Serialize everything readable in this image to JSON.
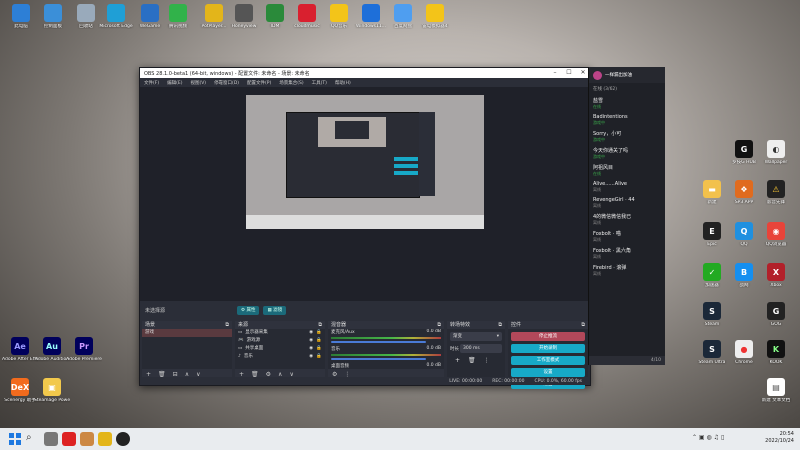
{
  "desktop": {
    "top_icons": [
      {
        "label": "此电脑",
        "color": "#2d7fd6"
      },
      {
        "label": "控制面板",
        "color": "#3b8fd8"
      },
      {
        "label": "回收站",
        "color": "#9ab"
      },
      {
        "label": "Microsoft Edge",
        "color": "#1f9fd6"
      },
      {
        "label": "WeGame",
        "color": "#2a6fc4"
      },
      {
        "label": "腾讯视频",
        "color": "#31b24a"
      },
      {
        "label": "PotPlayer...",
        "color": "#e3b51a"
      },
      {
        "label": "Honeyview",
        "color": "#555"
      },
      {
        "label": "IDM",
        "color": "#2a8a3a"
      },
      {
        "label": "cloudmusic",
        "color": "#d9202f"
      },
      {
        "label": "QQ音乐",
        "color": "#f3c419"
      },
      {
        "label": "Windows11...",
        "color": "#1e6fd9"
      },
      {
        "label": "百度网盘",
        "color": "#4f9ef0"
      },
      {
        "label": "雷电模拟器4",
        "color": "#f3c419"
      }
    ],
    "left_icons": [
      {
        "label": "Adobe After Effects 2021",
        "glyph": "Ae",
        "color": "#00005b",
        "fg": "#9999ff"
      },
      {
        "label": "Adobe Audition",
        "glyph": "Au",
        "color": "#00005b",
        "fg": "#9ff"
      },
      {
        "label": "Adobe Premiere",
        "glyph": "Pr",
        "color": "#00005b",
        "fg": "#c9f"
      },
      {
        "label": "Scenergy 助手",
        "glyph": "DeX",
        "color": "#f26b1d",
        "fg": "#fff"
      },
      {
        "label": "Steamage Power 助手",
        "glyph": "▣",
        "color": "#f2c94c",
        "fg": "#fff"
      }
    ],
    "right_icons": [
      {
        "label": "罗技G HUB",
        "glyph": "G",
        "color": "#111",
        "fg": "#fff"
      },
      {
        "label": "Wallpaper",
        "glyph": "◐",
        "color": "#eee",
        "fg": "#333"
      },
      {
        "label": "影音先锋",
        "glyph": "⚠",
        "color": "#222",
        "fg": "#fc3"
      },
      {
        "label": "SP3 APP",
        "glyph": "❖",
        "color": "#e06b1e",
        "fg": "#fff"
      },
      {
        "label": "新建",
        "glyph": "▬",
        "color": "#f2c14c",
        "fg": "#fff"
      },
      {
        "label": "QQ",
        "glyph": "Q",
        "color": "#1f90e0",
        "fg": "#fff"
      },
      {
        "label": "QQ浏览器",
        "glyph": "◉",
        "color": "#e8443a",
        "fg": "#fff"
      },
      {
        "label": "Epic",
        "glyph": "E",
        "color": "#222",
        "fg": "#fff"
      },
      {
        "label": "加速器",
        "glyph": "✓",
        "color": "#2a2",
        "fg": "#fff"
      },
      {
        "label": "Xbox",
        "glyph": "X",
        "color": "#b2202a",
        "fg": "#fff"
      },
      {
        "label": "Steam",
        "glyph": "S",
        "color": "#1b2838",
        "fg": "#fff"
      },
      {
        "label": "战网",
        "glyph": "B",
        "color": "#158ff0",
        "fg": "#fff"
      },
      {
        "label": "GOG",
        "glyph": "G",
        "color": "#222",
        "fg": "#fff"
      },
      {
        "label": "Steam Ultra",
        "glyph": "S",
        "color": "#1b2838",
        "fg": "#fff"
      },
      {
        "label": "Chrome",
        "glyph": "●",
        "color": "#eee",
        "fg": "#e33"
      },
      {
        "label": "KOOK",
        "glyph": "K",
        "color": "#111",
        "fg": "#8f8"
      },
      {
        "label": "新建 文本文档",
        "glyph": "▤",
        "color": "#fff",
        "fg": "#555"
      }
    ]
  },
  "obs": {
    "title": "OBS 28.1.0-beta1 (64-bit, windows) - 配置文件: 未命名 - 场景: 未命名",
    "menu": [
      "文件(F)",
      "编辑(E)",
      "视图(V)",
      "停靠窗口(D)",
      "配置文件(P)",
      "场景集合(S)",
      "工具(T)",
      "帮助(H)"
    ],
    "no_source": "未选择源",
    "props_btn": "属性",
    "filters_btn": "滤镜",
    "scenes_title": "场景",
    "scenes": [
      "游戏"
    ],
    "sources_title": "来源",
    "sources": [
      "显示器采集",
      "游戏源",
      "共享桌面",
      "音乐"
    ],
    "mixer_title": "混音器",
    "mixer": [
      {
        "name": "麦克风/Aux",
        "db": "0.0 dB"
      },
      {
        "name": "音乐",
        "db": "0.0 dB"
      },
      {
        "name": "桌面音频",
        "db": "0.0 dB"
      }
    ],
    "transitions_title": "转场特效",
    "transition": "渐变",
    "duration_label": "时长",
    "duration": "300 ms",
    "controls_title": "控件",
    "controls": [
      "停止推流",
      "开始录制",
      "工作室模式",
      "设置",
      "退出"
    ],
    "status": {
      "live": "LIVE: 00:00:00",
      "rec": "REC: 00:00:00",
      "cpu": "CPU: 0.0%, 60.00 fps"
    }
  },
  "chat": {
    "header": "一样漏出加油",
    "section": "在线 (3/62)",
    "items": [
      {
        "name": "盐雪",
        "status": "在线"
      },
      {
        "name": "Badintentions",
        "status": "游戏中"
      },
      {
        "name": "Sorry，小可",
        "status": "游戏中"
      },
      {
        "name": "今天你通关了吗",
        "status": "游戏中"
      },
      {
        "name": "阿祖风目",
        "status": "在线"
      },
      {
        "name": "Alive......Alive",
        "status": "离线"
      },
      {
        "name": "RevengeGirl · 44",
        "status": "离线"
      },
      {
        "name": "4的微信微信我已",
        "status": "离线"
      },
      {
        "name": "Foxbolt · 喵",
        "status": "离线"
      },
      {
        "name": "Foxbolt · 黑六角",
        "status": "离线"
      },
      {
        "name": "Firebird · 滚弹",
        "status": "离线"
      }
    ],
    "footer_count": "4/10"
  },
  "taskbar": {
    "time": "20:54",
    "date": "2022/10/24"
  }
}
